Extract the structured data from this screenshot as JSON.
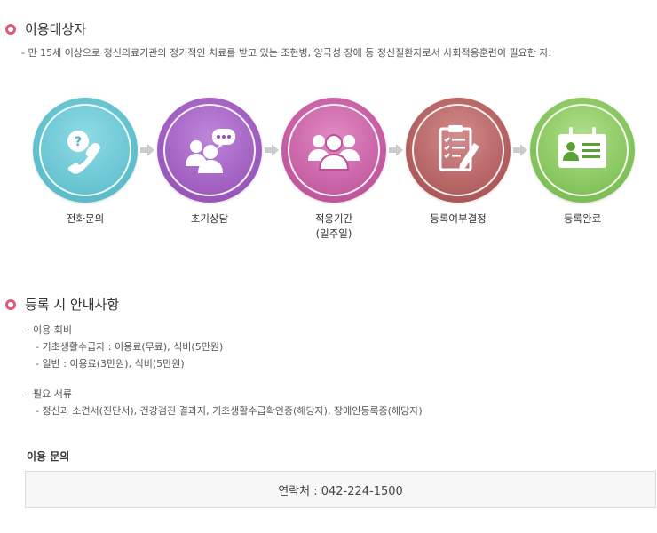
{
  "section1": {
    "title": "이용대상자",
    "description": "- 만 15세 이상으로 정신의료기관의 정기적인 치료를 받고 있는 조현병, 양극성 장애 등 정신질환자로서 사회적응훈련이 필요한 자."
  },
  "steps": [
    {
      "label": "전화문의",
      "icon": "phone-question-icon",
      "color": "#5fc2cf"
    },
    {
      "label": "초기상담",
      "icon": "chat-people-icon",
      "color": "#a35bc2"
    },
    {
      "label": "적응기간",
      "sublabel": "(일주일)",
      "icon": "group-icon",
      "color": "#c95aa6"
    },
    {
      "label": "등록여부결정",
      "icon": "checklist-icon",
      "color": "#b85d5d"
    },
    {
      "label": "등록완료",
      "icon": "id-card-icon",
      "color": "#7dc24f"
    }
  ],
  "section2": {
    "title": "등록 시 안내사항",
    "fee_heading": "· 이용 회비",
    "fee_items": [
      "- 기초생활수급자 : 이용료(무료), 식비(5만원)",
      "- 일반 : 이용료(3만원), 식비(5만원)"
    ],
    "docs_heading": "· 필요 서류",
    "docs_items": [
      "- 정신과 소견서(진단서), 건강검진 결과지, 기초생활수급확인증(해당자), 장애인등록증(해당자)"
    ]
  },
  "contact": {
    "title": "이용 문의",
    "text": "연락처 : 042-224-1500"
  }
}
